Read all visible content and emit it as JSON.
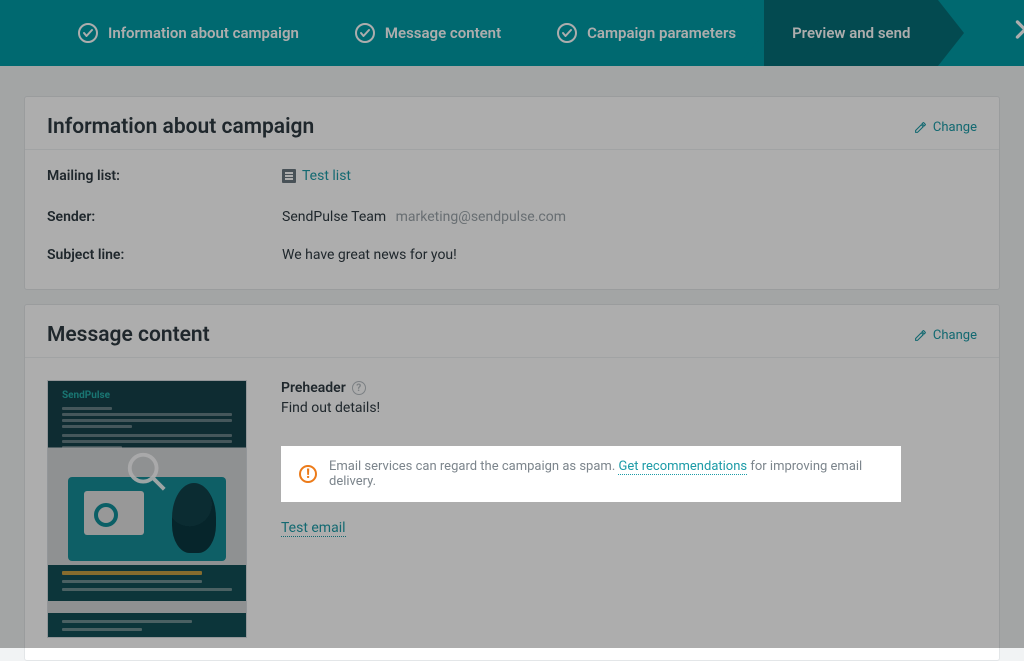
{
  "stepper": {
    "items": [
      {
        "label": "Information about campaign",
        "done": true
      },
      {
        "label": "Message content",
        "done": true
      },
      {
        "label": "Campaign parameters",
        "done": true
      },
      {
        "label": "Preview and send",
        "active": true
      }
    ]
  },
  "change_label": "Change",
  "info_card": {
    "title": "Information about campaign",
    "mailing_list_label": "Mailing list:",
    "mailing_list_value": "Test list",
    "sender_label": "Sender:",
    "sender_name": "SendPulse Team",
    "sender_email": "marketing@sendpulse.com",
    "subject_label": "Subject line:",
    "subject_value": "We have great news for you!"
  },
  "message_card": {
    "title": "Message content",
    "preheader_label": "Preheader",
    "preheader_value": "Find out details!",
    "thumb_brand": "SendPulse",
    "alert_text_before": "Email services can regard the campaign as spam. ",
    "alert_link": "Get recommendations",
    "alert_text_after": " for improving email delivery.",
    "test_email_label": "Test email"
  }
}
